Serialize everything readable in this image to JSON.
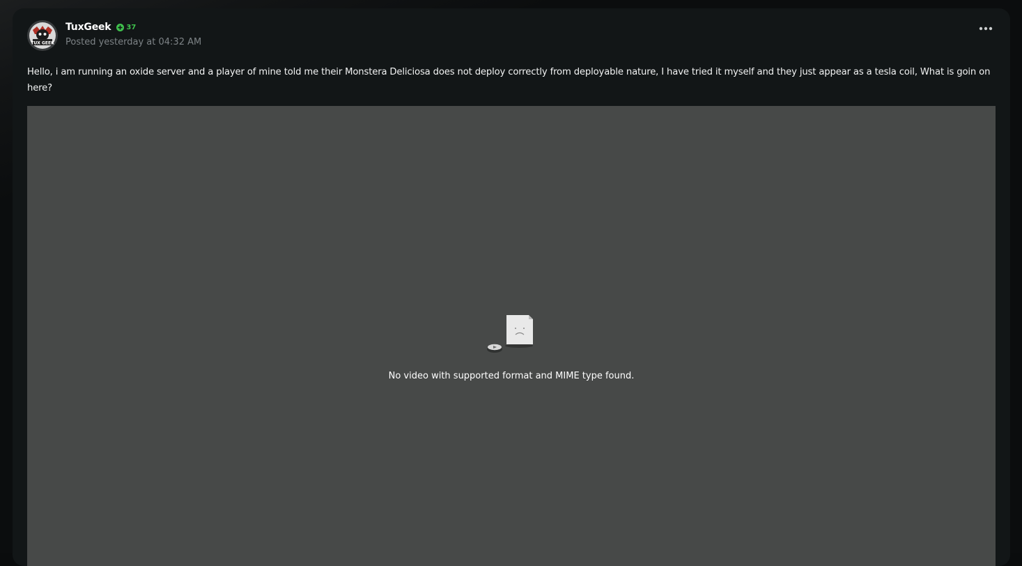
{
  "post": {
    "author": {
      "name": "TuxGeek",
      "reputation": "37",
      "avatar_text": "TUX GEEK"
    },
    "posted_time": "Posted yesterday at 04:32 AM",
    "body": "Hello, i am running an oxide server and a player of mine told me their Monstera Deliciosa does not deploy correctly from deployable nature, I have tried it myself and they just appear as a tesla coil, What is goin on here?",
    "video": {
      "error_message": "No video with supported format and MIME type found."
    },
    "more_icon": "ellipsis-icon"
  },
  "colors": {
    "page_bg": "#0a0c0d",
    "card_bg": "#121617",
    "reputation_green": "#3fc24d",
    "muted_text": "#7d8386",
    "video_bg": "#474948"
  }
}
